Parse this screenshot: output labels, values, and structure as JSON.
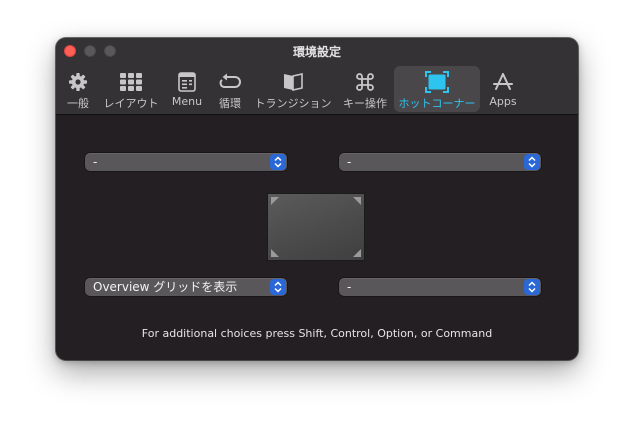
{
  "window": {
    "title": "環境設定"
  },
  "toolbar": {
    "tabs": [
      {
        "label": "一般",
        "icon": "gear-icon"
      },
      {
        "label": "レイアウト",
        "icon": "grid-icon"
      },
      {
        "label": "Menu",
        "icon": "menu-icon"
      },
      {
        "label": "循環",
        "icon": "cycle-icon"
      },
      {
        "label": "トランジション",
        "icon": "transition-icon"
      },
      {
        "label": "キー操作",
        "icon": "command-key-icon"
      },
      {
        "label": "ホットコーナー",
        "icon": "hot-corners-icon",
        "selected": true
      },
      {
        "label": "Apps",
        "icon": "apps-icon"
      }
    ]
  },
  "hot_corners": {
    "top_left": "-",
    "top_right": "-",
    "bottom_left": "Overview グリッドを表示",
    "bottom_right": "-"
  },
  "footer": {
    "hint": "For additional choices press Shift, Control, Option, or Command"
  },
  "colors": {
    "accent": "#2ec4f0",
    "stepper_blue": "#2a68d8",
    "close": "#ff5f57"
  }
}
